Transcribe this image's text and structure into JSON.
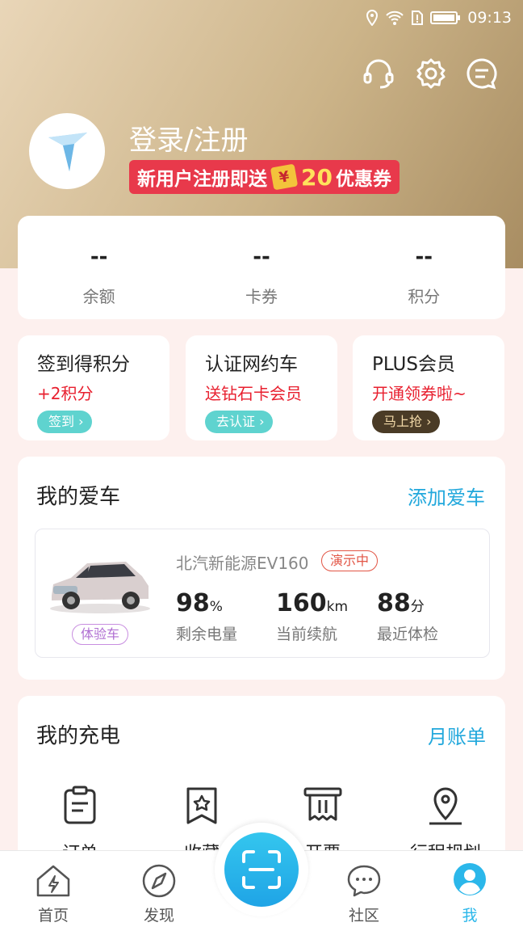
{
  "status_bar": {
    "time": "09:13"
  },
  "header": {
    "login_label": "登录/注册",
    "promo_text": "新用户注册即送",
    "promo_amount": "20",
    "promo_suffix": "优惠券",
    "coupon_glyph": "¥"
  },
  "stats": [
    {
      "value": "--",
      "label": "余额"
    },
    {
      "value": "--",
      "label": "卡券"
    },
    {
      "value": "--",
      "label": "积分"
    }
  ],
  "promos": [
    {
      "title": "签到得积分",
      "subtitle": "+2积分",
      "button": "签到",
      "button_color": "#5fd3cf"
    },
    {
      "title": "认证网约车",
      "subtitle": "送钻石卡会员",
      "button": "去认证",
      "button_color": "#5fd3cf"
    },
    {
      "title": "PLUS会员",
      "subtitle": "开通领券啦~",
      "button": "马上抢",
      "button_color": "#4a3b26"
    }
  ],
  "my_car": {
    "title": "我的爱车",
    "add_link": "添加爱车",
    "tag": "体验车",
    "name": "北汽新能源EV160",
    "status": "演示中",
    "stats": [
      {
        "value": "98",
        "unit": "%",
        "label": "剩余电量"
      },
      {
        "value": "160",
        "unit": "km",
        "label": "当前续航"
      },
      {
        "value": "88",
        "unit": "分",
        "label": "最近体检"
      }
    ]
  },
  "my_charging": {
    "title": "我的充电",
    "link": "月账单",
    "items": [
      {
        "label": "订单",
        "icon": "clipboard-icon"
      },
      {
        "label": "收藏",
        "icon": "bookmark-star-icon"
      },
      {
        "label": "开票",
        "icon": "invoice-icon"
      },
      {
        "label": "行程规划",
        "icon": "location-pin-icon"
      }
    ]
  },
  "tabbar": {
    "home": "首页",
    "discover": "发现",
    "community": "社区",
    "me": "我"
  },
  "colors": {
    "accent": "#22a8dc",
    "promo_red": "#e8394b",
    "header_gold": "#ccb489"
  }
}
